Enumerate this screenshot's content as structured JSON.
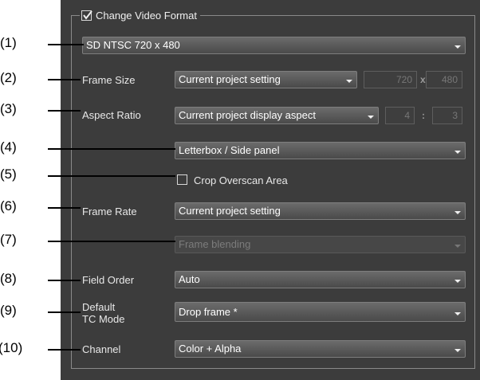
{
  "group_title": "Change Video Format",
  "group_checked": true,
  "format_preset": "SD NTSC 720 x 480",
  "rows": {
    "frame_size": {
      "label": "Frame Size",
      "value": "Current project setting",
      "width": "720",
      "sep": "x",
      "height": "480"
    },
    "aspect_ratio": {
      "label": "Aspect Ratio",
      "value": "Current project display aspect",
      "w": "4",
      "sep": ":",
      "h": "3"
    },
    "letterbox": {
      "value": "Letterbox / Side panel"
    },
    "crop": {
      "label": "Crop Overscan Area",
      "checked": false
    },
    "frame_rate": {
      "label": "Frame Rate",
      "value": "Current project setting"
    },
    "blending": {
      "value": "Frame blending"
    },
    "field_order": {
      "label": "Field Order",
      "value": "Auto"
    },
    "tc_mode": {
      "label_line1": "Default",
      "label_line2": "TC Mode",
      "value": "Drop frame *"
    },
    "channel": {
      "label": "Channel",
      "value": "Color + Alpha"
    }
  },
  "callouts": [
    "(1)",
    "(2)",
    "(3)",
    "(4)",
    "(5)",
    "(6)",
    "(7)",
    "(8)",
    "(9)",
    "(10)"
  ]
}
